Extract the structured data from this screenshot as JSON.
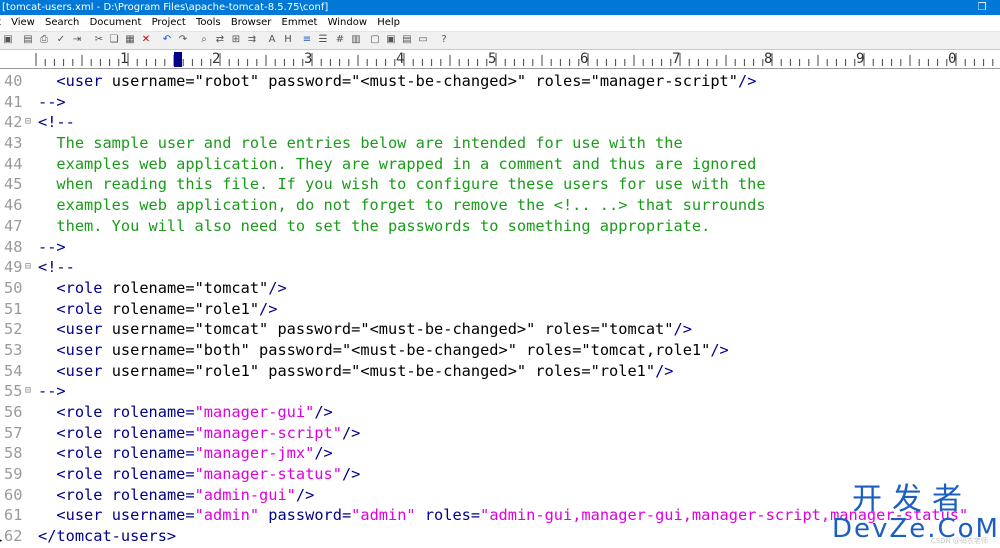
{
  "window": {
    "title": "[tomcat-users.xml - D:\\Program Files\\apache-tomcat-8.5.75\\conf]"
  },
  "menu": [
    "t",
    "View",
    "Search",
    "Document",
    "Project",
    "Tools",
    "Browser",
    "Emmet",
    "Window",
    "Help"
  ],
  "ruler_numbers": [
    "1",
    "2",
    "3",
    "4",
    "5",
    "6",
    "7",
    "8",
    "9",
    "0"
  ],
  "editor": {
    "lines": [
      {
        "n": "40",
        "tokens": [
          [
            "t",
            "  <user "
          ],
          [
            "a",
            "username="
          ],
          [
            "a",
            "\"robot\" "
          ],
          [
            "a",
            "password="
          ],
          [
            "a",
            "\"<must-be-changed>\" "
          ],
          [
            "a",
            "roles="
          ],
          [
            "a",
            "\"manager-script\""
          ],
          [
            "t",
            "/>"
          ]
        ]
      },
      {
        "n": "41",
        "tokens": [
          [
            "t",
            "-->"
          ]
        ]
      },
      {
        "n": "42",
        "fold": true,
        "tokens": [
          [
            "t",
            "<!--"
          ]
        ]
      },
      {
        "n": "43",
        "tokens": [
          [
            "c",
            "  The sample user and role entries below are intended for use with the"
          ]
        ]
      },
      {
        "n": "44",
        "tokens": [
          [
            "c",
            "  examples web application. They are wrapped in a comment and thus are ignored"
          ]
        ]
      },
      {
        "n": "45",
        "tokens": [
          [
            "c",
            "  when reading this file. If you wish to configure these users for use with the"
          ]
        ]
      },
      {
        "n": "46",
        "tokens": [
          [
            "c",
            "  examples web application, do not forget to remove the <!.. ..> that surrounds"
          ]
        ]
      },
      {
        "n": "47",
        "tokens": [
          [
            "c",
            "  them. You will also need to set the passwords to something appropriate."
          ]
        ]
      },
      {
        "n": "48",
        "tokens": [
          [
            "t",
            "-->"
          ]
        ]
      },
      {
        "n": "49",
        "fold": true,
        "tokens": [
          [
            "t",
            "<!--"
          ]
        ]
      },
      {
        "n": "50",
        "tokens": [
          [
            "t",
            "  <role "
          ],
          [
            "a",
            "rolename="
          ],
          [
            "a",
            "\"tomcat\""
          ],
          [
            "t",
            "/>"
          ]
        ]
      },
      {
        "n": "51",
        "tokens": [
          [
            "t",
            "  <role "
          ],
          [
            "a",
            "rolename="
          ],
          [
            "a",
            "\"role1\""
          ],
          [
            "t",
            "/>"
          ]
        ]
      },
      {
        "n": "52",
        "tokens": [
          [
            "t",
            "  <user "
          ],
          [
            "a",
            "username="
          ],
          [
            "a",
            "\"tomcat\" "
          ],
          [
            "a",
            "password="
          ],
          [
            "a",
            "\"<must-be-changed>\" "
          ],
          [
            "a",
            "roles="
          ],
          [
            "a",
            "\"tomcat\""
          ],
          [
            "t",
            "/>"
          ]
        ]
      },
      {
        "n": "53",
        "tokens": [
          [
            "t",
            "  <user "
          ],
          [
            "a",
            "username="
          ],
          [
            "a",
            "\"both\" "
          ],
          [
            "a",
            "password="
          ],
          [
            "a",
            "\"<must-be-changed>\" "
          ],
          [
            "a",
            "roles="
          ],
          [
            "a",
            "\"tomcat,role1\""
          ],
          [
            "t",
            "/>"
          ]
        ]
      },
      {
        "n": "54",
        "tokens": [
          [
            "t",
            "  <user "
          ],
          [
            "a",
            "username="
          ],
          [
            "a",
            "\"role1\" "
          ],
          [
            "a",
            "password="
          ],
          [
            "a",
            "\"<must-be-changed>\" "
          ],
          [
            "a",
            "roles="
          ],
          [
            "a",
            "\"role1\""
          ],
          [
            "t",
            "/>"
          ]
        ]
      },
      {
        "n": "55",
        "fold": true,
        "tokens": [
          [
            "t",
            "-->"
          ]
        ]
      },
      {
        "n": "56",
        "tokens": [
          [
            "t",
            "  <role "
          ],
          [
            "t",
            "rolename="
          ],
          [
            "v",
            "\"manager-gui\""
          ],
          [
            "t",
            "/>"
          ]
        ]
      },
      {
        "n": "57",
        "tokens": [
          [
            "t",
            "  <role "
          ],
          [
            "t",
            "rolename="
          ],
          [
            "v",
            "\"manager-script\""
          ],
          [
            "t",
            "/>"
          ]
        ]
      },
      {
        "n": "58",
        "tokens": [
          [
            "t",
            "  <role "
          ],
          [
            "t",
            "rolename="
          ],
          [
            "v",
            "\"manager-jmx\""
          ],
          [
            "t",
            "/>"
          ]
        ]
      },
      {
        "n": "59",
        "tokens": [
          [
            "t",
            "  <role "
          ],
          [
            "t",
            "rolename="
          ],
          [
            "v",
            "\"manager-status\""
          ],
          [
            "t",
            "/>"
          ]
        ]
      },
      {
        "n": "60",
        "tokens": [
          [
            "t",
            "  <role "
          ],
          [
            "t",
            "rolename="
          ],
          [
            "v",
            "\"admin-gui\""
          ],
          [
            "t",
            "/>"
          ]
        ]
      },
      {
        "n": "61",
        "tokens": [
          [
            "t",
            "  <user "
          ],
          [
            "t",
            "username="
          ],
          [
            "v",
            "\"admin\" "
          ],
          [
            "t",
            "password="
          ],
          [
            "v",
            "\"admin\" "
          ],
          [
            "t",
            "roles="
          ],
          [
            "v",
            "\"admin-gui,manager-gui,manager-script,manager-status\""
          ]
        ]
      },
      {
        "n": "62",
        "tokens": [
          [
            "t",
            "</tomcat-users>"
          ]
        ]
      }
    ]
  },
  "watermark": {
    "line1": "开发者",
    "line2": "DevZe.CoM",
    "credit": "CSDN @码农老师"
  }
}
